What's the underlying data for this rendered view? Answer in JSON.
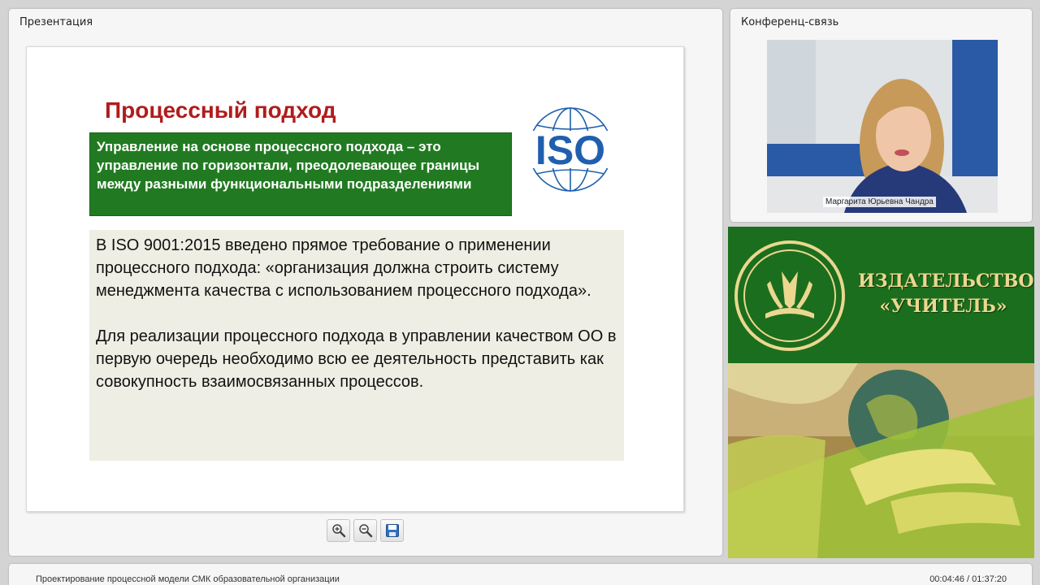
{
  "presentation": {
    "panel_title": "Презентация",
    "slide": {
      "title": "Процессный подход",
      "definition": "Управление на основе процессного подхода – это управление по горизонтали, преодолевающее границы между разными функциональными подразделениями",
      "logo_text": "ISO",
      "paragraph1": "В ISO 9001:2015 введено прямое требование о применении процессного подхода: «организация должна строить систему менеджмента качества с использованием процессного подхода».",
      "paragraph2": "Для реализации процессного подхода в управлении качеством ОО в первую очередь необходимо всю ее деятельность представить как совокупность взаимосвязанных процессов."
    },
    "toolbar": {
      "icons": [
        "zoom-in-icon",
        "zoom-out-icon",
        "save-icon"
      ]
    }
  },
  "conference": {
    "panel_title": "Конференц-связь",
    "speaker_name": "Маргарита Юрьевна Чандра"
  },
  "ad": {
    "line1": "ИЗДАТЕЛЬСТВО",
    "line2": "«УЧИТЕЛЬ»"
  },
  "footer": {
    "title": "Проектирование процессной модели СМК образовательной организации",
    "time": "00:04:46 / 01:37:20"
  },
  "colors": {
    "slide_title": "#b11c1c",
    "definition_bg": "#217a21",
    "iso_blue": "#1f5fae",
    "ad_green": "#1b6e1d",
    "ad_gold": "#ecd790"
  }
}
